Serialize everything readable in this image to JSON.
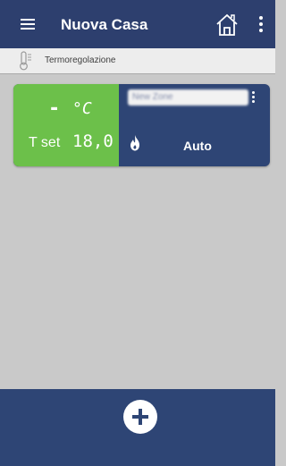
{
  "header": {
    "title": "Nuova Casa",
    "menu_icon": "hamburger-menu-icon",
    "home_icon": "home-icon",
    "more_icon": "more-vert-icon"
  },
  "section": {
    "icon": "thermometer-icon",
    "label": "Termoregolazione"
  },
  "zone": {
    "current_temp": "-",
    "temp_unit": "°C",
    "setpoint_label": "T set",
    "setpoint_value": "18,0",
    "name": "New Zone",
    "mode_icon": "flame-icon",
    "mode": "Auto",
    "more_icon": "more-vert-icon"
  },
  "footer": {
    "add_icon": "plus-icon"
  },
  "colors": {
    "primary": "#2d3f6e",
    "active_green": "#6cc04a",
    "background": "#c9c9c9"
  }
}
